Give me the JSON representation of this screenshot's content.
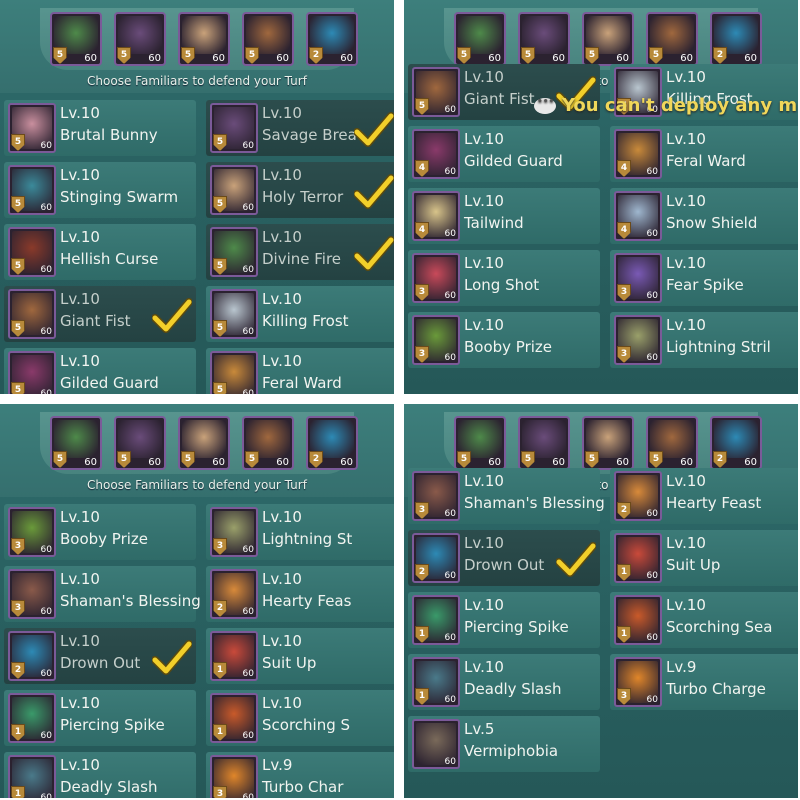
{
  "instruction": "Choose Familiars to defend your Turf",
  "toast": "You can't deploy any m",
  "team": [
    {
      "icon": "green-dragon-icon",
      "rank": "5",
      "level": "60",
      "color": "#4e8a4a"
    },
    {
      "icon": "savage-beast-icon",
      "rank": "5",
      "level": "60",
      "color": "#6a4c7a"
    },
    {
      "icon": "holy-terror-icon",
      "rank": "5",
      "level": "60",
      "color": "#c9a27a"
    },
    {
      "icon": "brown-beast-icon",
      "rank": "5",
      "level": "60",
      "color": "#a0683e"
    },
    {
      "icon": "blue-flame-icon",
      "rank": "2",
      "level": "60",
      "color": "#2d8ab5"
    }
  ],
  "panels": [
    {
      "cards": [
        {
          "level": "Lv.10",
          "name": "Brutal Bunny",
          "rank": "5",
          "lv": "60",
          "selected": false,
          "icon": "brutal-bunny-icon",
          "color": "#c98f9e"
        },
        {
          "level": "Lv.10",
          "name": "Savage Breat",
          "rank": "5",
          "lv": "60",
          "selected": true,
          "icon": "savage-breath-icon",
          "color": "#6a4c7a"
        },
        {
          "level": "Lv.10",
          "name": "Stinging Swarm",
          "rank": "5",
          "lv": "60",
          "selected": false,
          "icon": "stinging-swarm-icon",
          "color": "#3b8a9a"
        },
        {
          "level": "Lv.10",
          "name": "Holy Terror",
          "rank": "5",
          "lv": "60",
          "selected": true,
          "icon": "holy-terror-icon",
          "color": "#c9a27a"
        },
        {
          "level": "Lv.10",
          "name": "Hellish Curse",
          "rank": "5",
          "lv": "60",
          "selected": false,
          "icon": "hellish-curse-icon",
          "color": "#8a3a2a"
        },
        {
          "level": "Lv.10",
          "name": "Divine Fire",
          "rank": "5",
          "lv": "60",
          "selected": true,
          "icon": "divine-fire-icon",
          "color": "#4e8a4a"
        },
        {
          "level": "Lv.10",
          "name": "Giant Fist",
          "rank": "5",
          "lv": "60",
          "selected": true,
          "icon": "giant-fist-icon",
          "color": "#a0683e"
        },
        {
          "level": "Lv.10",
          "name": "Killing Frost",
          "rank": "5",
          "lv": "60",
          "selected": false,
          "icon": "killing-frost-icon",
          "color": "#b9c6cf"
        },
        {
          "level": "Lv.10",
          "name": "Gilded Guard",
          "rank": "5",
          "lv": "60",
          "selected": false,
          "icon": "gilded-guard-icon",
          "color": "#8a3a6a"
        },
        {
          "level": "Lv.10",
          "name": "Feral Ward",
          "rank": "5",
          "lv": "60",
          "selected": false,
          "icon": "feral-ward-icon",
          "color": "#c98a3a"
        }
      ]
    },
    {
      "cards": [
        {
          "level": "Lv.10",
          "name": "Giant Fist",
          "rank": "5",
          "lv": "60",
          "selected": true,
          "icon": "giant-fist-icon",
          "color": "#a0683e"
        },
        {
          "level": "Lv.10",
          "name": "Killing Frost",
          "rank": "5",
          "lv": "60",
          "selected": false,
          "icon": "killing-frost-icon",
          "color": "#b9c6cf"
        },
        {
          "level": "Lv.10",
          "name": "Gilded Guard",
          "rank": "4",
          "lv": "60",
          "selected": false,
          "icon": "gilded-guard-icon",
          "color": "#8a3a6a"
        },
        {
          "level": "Lv.10",
          "name": "Feral Ward",
          "rank": "4",
          "lv": "60",
          "selected": false,
          "icon": "feral-ward-icon",
          "color": "#c98a3a"
        },
        {
          "level": "Lv.10",
          "name": "Tailwind",
          "rank": "4",
          "lv": "60",
          "selected": false,
          "icon": "tailwind-icon",
          "color": "#d8c48a"
        },
        {
          "level": "Lv.10",
          "name": "Snow Shield",
          "rank": "4",
          "lv": "60",
          "selected": false,
          "icon": "snow-shield-icon",
          "color": "#9fb7cf"
        },
        {
          "level": "Lv.10",
          "name": "Long Shot",
          "rank": "3",
          "lv": "60",
          "selected": false,
          "icon": "long-shot-icon",
          "color": "#c94a5a"
        },
        {
          "level": "Lv.10",
          "name": "Fear Spike",
          "rank": "3",
          "lv": "60",
          "selected": false,
          "icon": "fear-spike-icon",
          "color": "#7a5ab5"
        },
        {
          "level": "Lv.10",
          "name": "Booby Prize",
          "rank": "3",
          "lv": "60",
          "selected": false,
          "icon": "booby-prize-icon",
          "color": "#6a9a3a"
        },
        {
          "level": "Lv.10",
          "name": "Lightning Stril",
          "rank": "3",
          "lv": "60",
          "selected": false,
          "icon": "lightning-strike-icon",
          "color": "#9aa06a"
        }
      ]
    },
    {
      "cards": [
        {
          "level": "Lv.10",
          "name": "Booby Prize",
          "rank": "3",
          "lv": "60",
          "selected": false,
          "icon": "booby-prize-icon",
          "color": "#6a9a3a"
        },
        {
          "level": "Lv.10",
          "name": "Lightning St",
          "rank": "3",
          "lv": "60",
          "selected": false,
          "icon": "lightning-strike-icon",
          "color": "#9aa06a"
        },
        {
          "level": "Lv.10",
          "name": "Shaman's Blessing",
          "rank": "3",
          "lv": "60",
          "selected": false,
          "icon": "shamans-blessing-icon",
          "color": "#8a5a4a"
        },
        {
          "level": "Lv.10",
          "name": "Hearty Feas",
          "rank": "2",
          "lv": "60",
          "selected": false,
          "icon": "hearty-feast-icon",
          "color": "#d88a3a"
        },
        {
          "level": "Lv.10",
          "name": "Drown Out",
          "rank": "2",
          "lv": "60",
          "selected": true,
          "icon": "drown-out-icon",
          "color": "#2d8ab5"
        },
        {
          "level": "Lv.10",
          "name": "Suit Up",
          "rank": "1",
          "lv": "60",
          "selected": false,
          "icon": "suit-up-icon",
          "color": "#c94a3a"
        },
        {
          "level": "Lv.10",
          "name": "Piercing Spike",
          "rank": "1",
          "lv": "60",
          "selected": false,
          "icon": "piercing-spike-icon",
          "color": "#3a9a6a"
        },
        {
          "level": "Lv.10",
          "name": "Scorching S",
          "rank": "1",
          "lv": "60",
          "selected": false,
          "icon": "scorching-sea-icon",
          "color": "#c95a2a"
        },
        {
          "level": "Lv.10",
          "name": "Deadly Slash",
          "rank": "1",
          "lv": "60",
          "selected": false,
          "icon": "deadly-slash-icon",
          "color": "#4a7a8a"
        },
        {
          "level": "Lv.9",
          "name": "Turbo Char",
          "rank": "3",
          "lv": "60",
          "selected": false,
          "icon": "turbo-charge-icon",
          "color": "#e0862a"
        }
      ]
    },
    {
      "cards": [
        {
          "level": "Lv.10",
          "name": "Shaman's Blessing",
          "rank": "3",
          "lv": "60",
          "selected": false,
          "icon": "shamans-blessing-icon",
          "color": "#8a5a4a"
        },
        {
          "level": "Lv.10",
          "name": "Hearty Feast",
          "rank": "2",
          "lv": "60",
          "selected": false,
          "icon": "hearty-feast-icon",
          "color": "#d88a3a"
        },
        {
          "level": "Lv.10",
          "name": "Drown Out",
          "rank": "2",
          "lv": "60",
          "selected": true,
          "icon": "drown-out-icon",
          "color": "#2d8ab5"
        },
        {
          "level": "Lv.10",
          "name": "Suit Up",
          "rank": "1",
          "lv": "60",
          "selected": false,
          "icon": "suit-up-icon",
          "color": "#c94a3a"
        },
        {
          "level": "Lv.10",
          "name": "Piercing Spike",
          "rank": "1",
          "lv": "60",
          "selected": false,
          "icon": "piercing-spike-icon",
          "color": "#3a9a6a"
        },
        {
          "level": "Lv.10",
          "name": "Scorching Sea",
          "rank": "1",
          "lv": "60",
          "selected": false,
          "icon": "scorching-sea-icon",
          "color": "#c95a2a"
        },
        {
          "level": "Lv.10",
          "name": "Deadly Slash",
          "rank": "1",
          "lv": "60",
          "selected": false,
          "icon": "deadly-slash-icon",
          "color": "#4a7a8a"
        },
        {
          "level": "Lv.9",
          "name": "Turbo Charge",
          "rank": "3",
          "lv": "60",
          "selected": false,
          "icon": "turbo-charge-icon",
          "color": "#e0862a"
        },
        {
          "level": "Lv.5",
          "name": "Vermiphobia",
          "rank": "",
          "lv": "60",
          "selected": false,
          "icon": "vermiphobia-icon",
          "color": "#7a6a5a"
        }
      ]
    }
  ]
}
